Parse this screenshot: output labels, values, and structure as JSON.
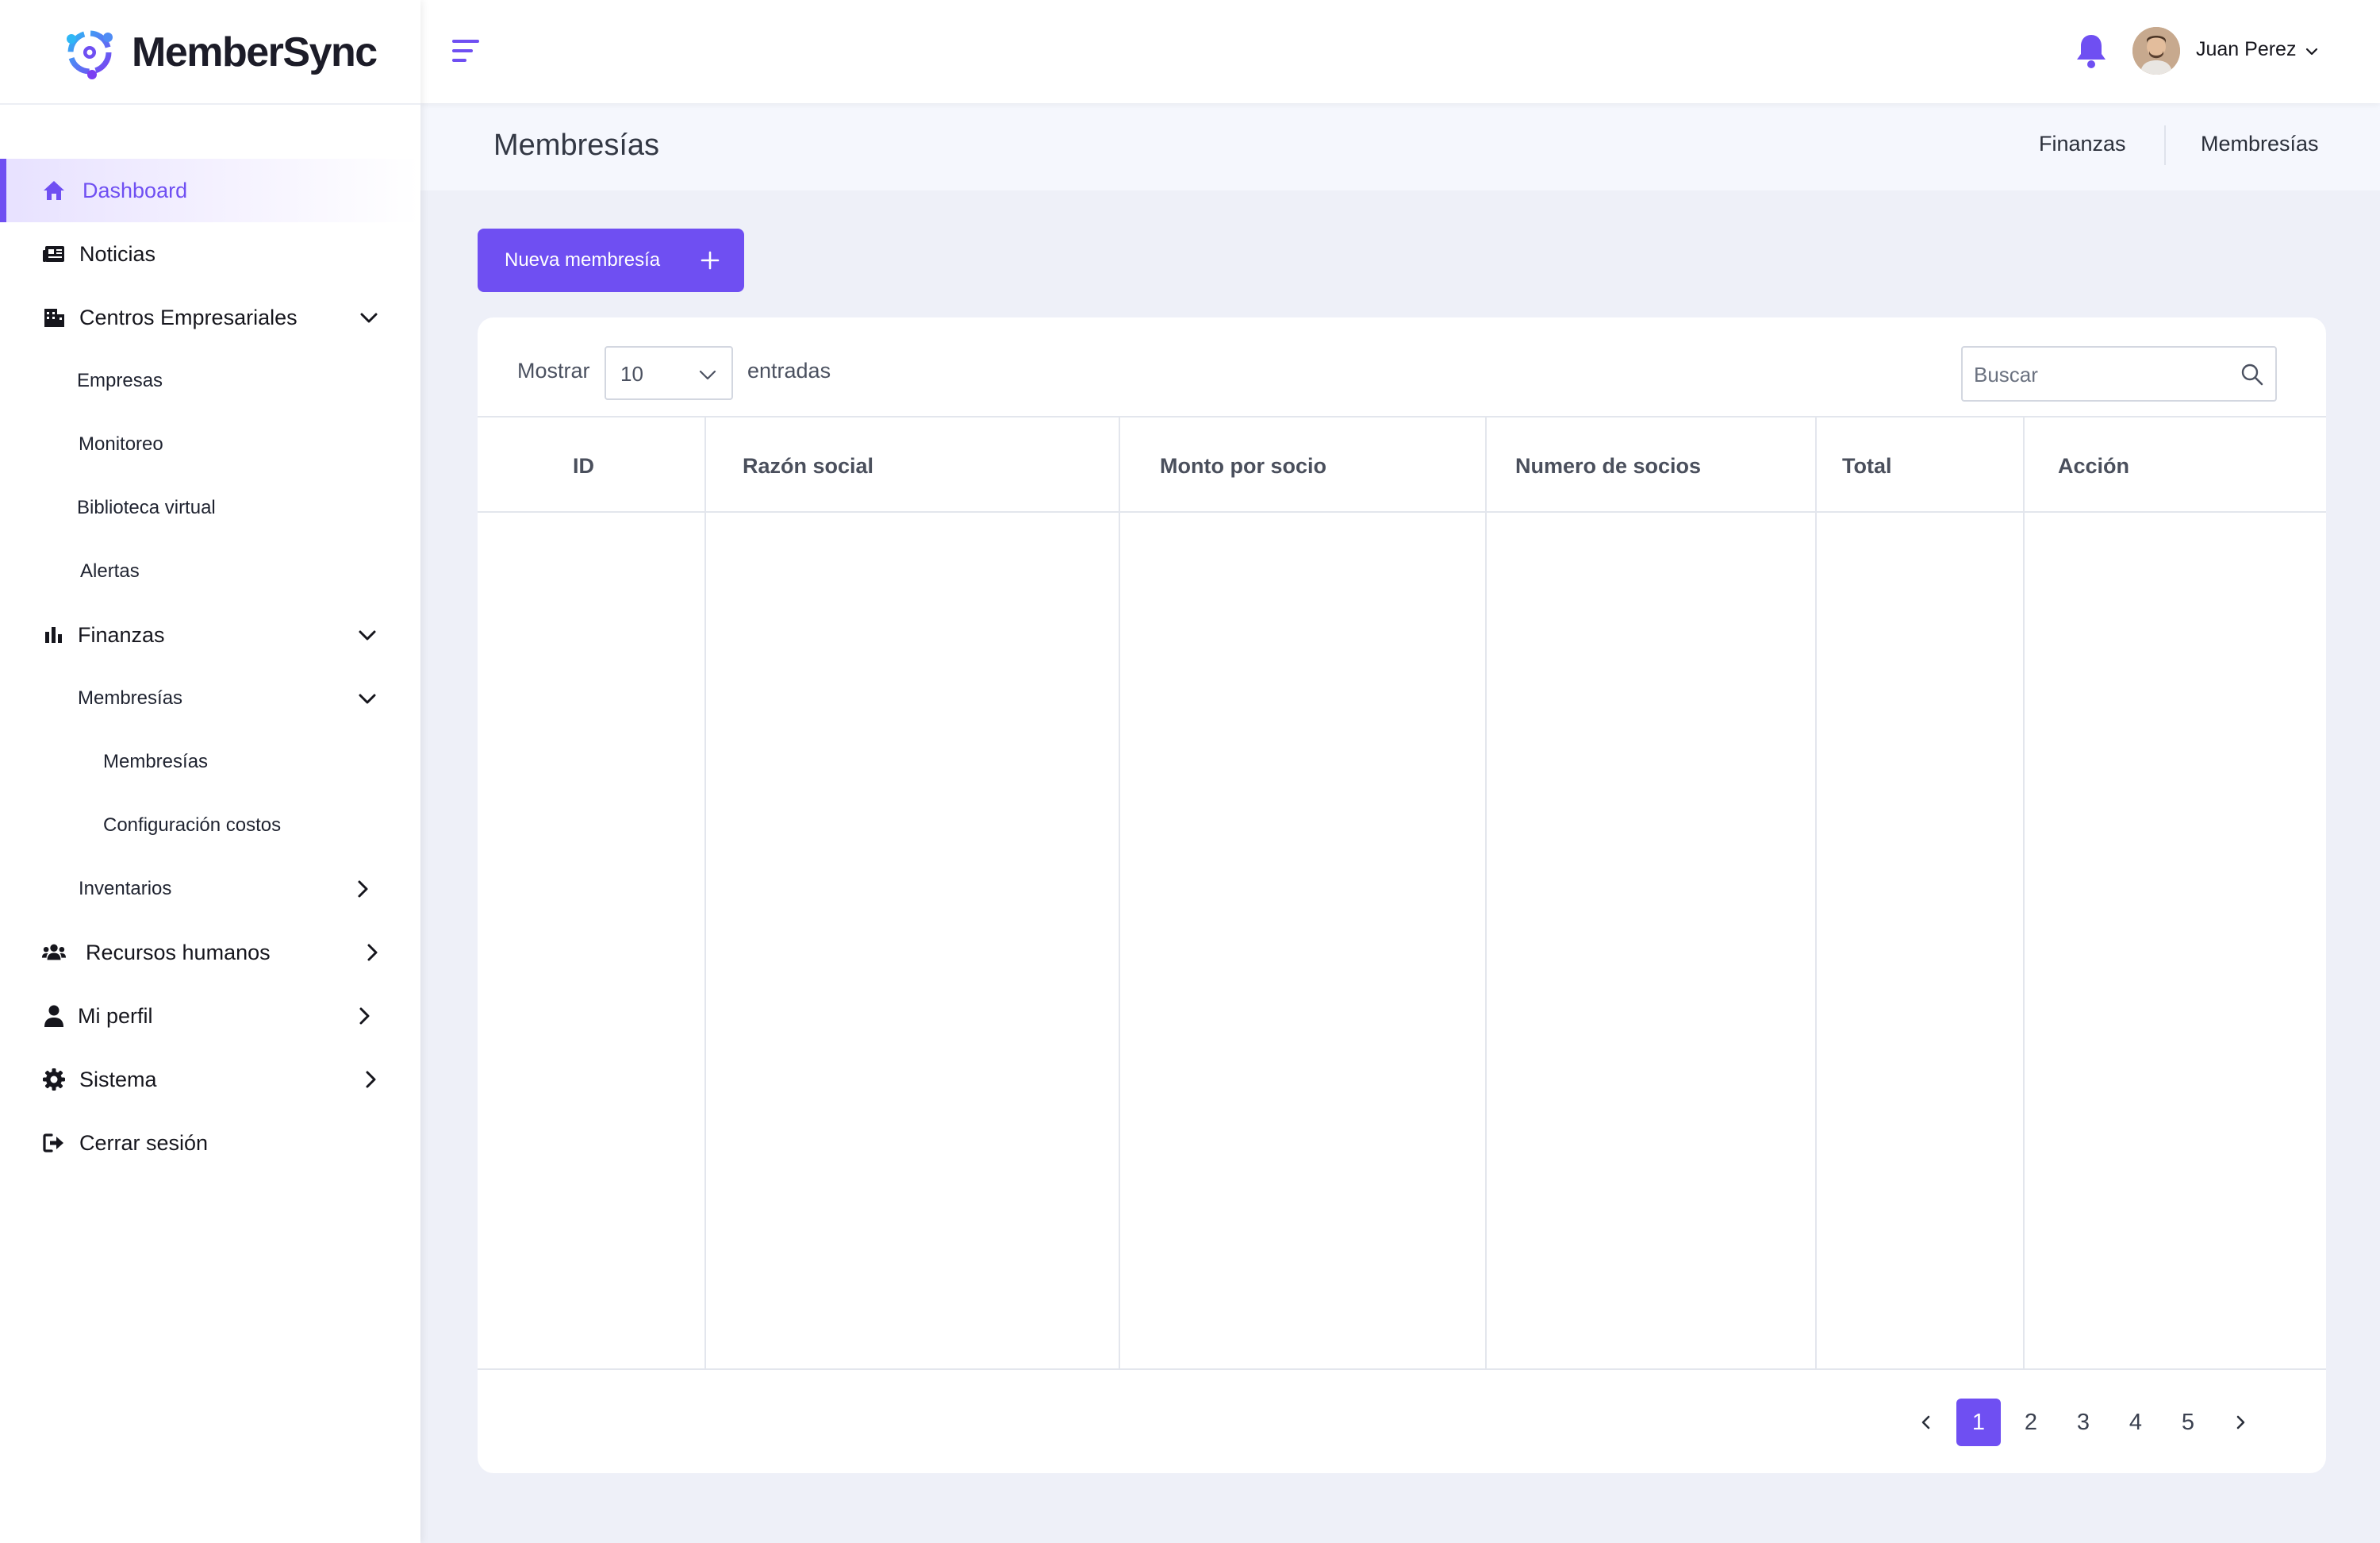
{
  "brand": {
    "name": "MemberSync"
  },
  "colors": {
    "accent": "#6f4ff2",
    "background": "#eef0f8"
  },
  "sidebar": {
    "items": [
      {
        "label": "Dashboard",
        "icon": "home-icon",
        "active": true
      },
      {
        "label": "Noticias",
        "icon": "newspaper-icon"
      },
      {
        "label": "Centros Empresariales",
        "icon": "building-icon",
        "expanded": true
      },
      {
        "label": "Empresas",
        "level": 1
      },
      {
        "label": "Monitoreo",
        "level": 1
      },
      {
        "label": "Biblioteca virtual",
        "level": 1
      },
      {
        "label": "Alertas",
        "level": 1
      },
      {
        "label": "Finanzas",
        "icon": "bar-chart-icon",
        "expanded": true
      },
      {
        "label": "Membresías",
        "level": 1,
        "expanded": true
      },
      {
        "label": "Membresías",
        "level": 2
      },
      {
        "label": "Configuración costos",
        "level": 2
      },
      {
        "label": "Inventarios",
        "level": 1,
        "expanded": false
      },
      {
        "label": "Recursos humanos",
        "icon": "users-icon",
        "expanded": false
      },
      {
        "label": "Mi perfil",
        "icon": "user-icon",
        "expanded": false
      },
      {
        "label": "Sistema",
        "icon": "gear-icon",
        "expanded": false
      },
      {
        "label": "Cerrar sesión",
        "icon": "logout-icon"
      }
    ]
  },
  "topbar": {
    "user_name": "Juan Perez"
  },
  "page": {
    "title": "Membresías",
    "breadcrumb": [
      "Finanzas",
      "Membresías"
    ]
  },
  "actions": {
    "new_button": "Nueva membresía"
  },
  "table_controls": {
    "show_label": "Mostrar",
    "page_size": "10",
    "entries_label": "entradas",
    "search_placeholder": "Buscar"
  },
  "table": {
    "columns": [
      "ID",
      "Razón social",
      "Monto por socio",
      "Numero de socios",
      "Total",
      "Acción"
    ],
    "rows": []
  },
  "pagination": {
    "pages": [
      "1",
      "2",
      "3",
      "4",
      "5"
    ],
    "current": "1"
  }
}
